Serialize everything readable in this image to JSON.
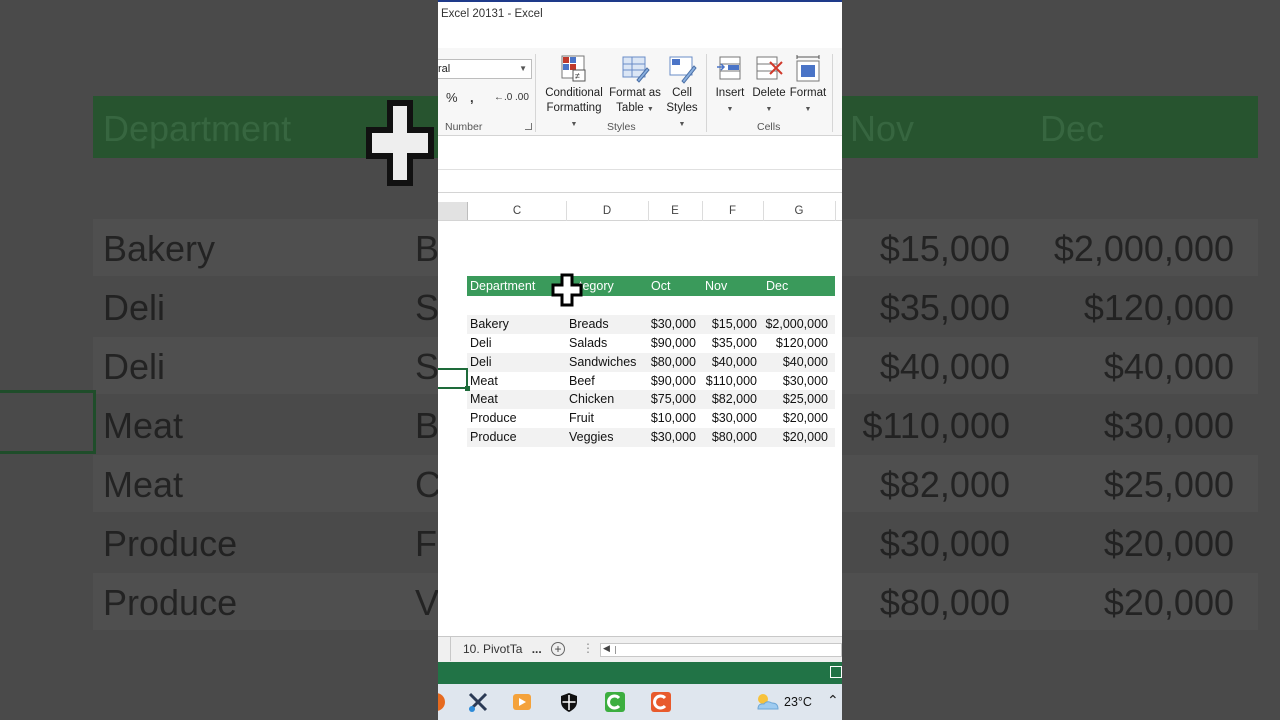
{
  "window": {
    "title": "Excel 20131 - Excel"
  },
  "ribbon": {
    "number_format_value": "ral",
    "percent_symbol": "%",
    "comma_symbol": ",",
    "increase_decimal": "←.0",
    "decrease_decimal": ".00",
    "number_group_label": "Number",
    "styles_group_label": "Styles",
    "cells_group_label": "Cells",
    "conditional_formatting": {
      "line1": "Conditional",
      "line2": "Formatting"
    },
    "format_as_table": {
      "line1": "Format as",
      "line2": "Table"
    },
    "cell_styles": {
      "line1": "Cell",
      "line2": "Styles"
    },
    "insert": "Insert",
    "delete": "Delete",
    "format": "Format"
  },
  "columns": [
    "C",
    "D",
    "E",
    "F",
    "G"
  ],
  "table": {
    "headers": [
      "Department",
      "Category",
      "Oct",
      "Nov",
      "Dec"
    ],
    "visible_category_header": "tegory",
    "rows": [
      [
        "Bakery",
        "Breads",
        "$30,000",
        "$15,000",
        "$2,000,000"
      ],
      [
        "Deli",
        "Salads",
        "$90,000",
        "$35,000",
        "$120,000"
      ],
      [
        "Deli",
        "Sandwiches",
        "$80,000",
        "$40,000",
        "$40,000"
      ],
      [
        "Meat",
        "Beef",
        "$90,000",
        "$110,000",
        "$30,000"
      ],
      [
        "Meat",
        "Chicken",
        "$75,000",
        "$82,000",
        "$25,000"
      ],
      [
        "Produce",
        "Fruit",
        "$10,000",
        "$30,000",
        "$20,000"
      ],
      [
        "Produce",
        "Veggies",
        "$30,000",
        "$80,000",
        "$20,000"
      ]
    ]
  },
  "sheet_tab": {
    "label": "10. PivotTa",
    "overflow": "..."
  },
  "taskbar": {
    "temperature": "23°C"
  },
  "colors": {
    "excel_green": "#217346",
    "table_header": "#3a9a5b"
  },
  "background": {
    "header": [
      "Department",
      "Nov",
      "Dec"
    ],
    "rows": [
      [
        "Bakery",
        "B",
        "$15,000",
        "$2,000,000"
      ],
      [
        "Deli",
        "S",
        "$35,000",
        "$120,000"
      ],
      [
        "Deli",
        "S",
        "$40,000",
        "$40,000"
      ],
      [
        "Meat",
        "B",
        "$110,000",
        "$30,000"
      ],
      [
        "Meat",
        "C",
        "$82,000",
        "$25,000"
      ],
      [
        "Produce",
        "F",
        "$30,000",
        "$20,000"
      ],
      [
        "Produce",
        "V",
        "$80,000",
        "$20,000"
      ]
    ]
  }
}
